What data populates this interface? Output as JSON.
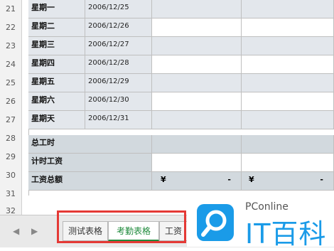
{
  "row_numbers": [
    "21",
    "22",
    "23",
    "24",
    "25",
    "26",
    "27",
    "28",
    "29",
    "30",
    "31",
    "32"
  ],
  "days": [
    {
      "label": "星期一",
      "date": "2006/12/25"
    },
    {
      "label": "星期二",
      "date": "2006/12/26"
    },
    {
      "label": "星期三",
      "date": "2006/12/27"
    },
    {
      "label": "星期四",
      "date": "2006/12/28"
    },
    {
      "label": "星期五",
      "date": "2006/12/29"
    },
    {
      "label": "星期六",
      "date": "2006/12/30"
    },
    {
      "label": "星期天",
      "date": "2006/12/31"
    }
  ],
  "summary": {
    "total_hours": "总工时",
    "hourly_wage": "计时工资",
    "total_wage": "工资总额",
    "currency": "¥",
    "dash": "-"
  },
  "tabs": [
    "测试表格",
    "考勤表格",
    "工资"
  ],
  "active_tab": "考勤表格",
  "nav": {
    "prev": "◀",
    "next": "▶"
  },
  "watermark": {
    "brand": "PConline",
    "logo_text": "IT百科"
  },
  "colors": {
    "highlight": "#e53935",
    "active_tab": "#1f8a3c",
    "logo": "#1a9be8"
  }
}
